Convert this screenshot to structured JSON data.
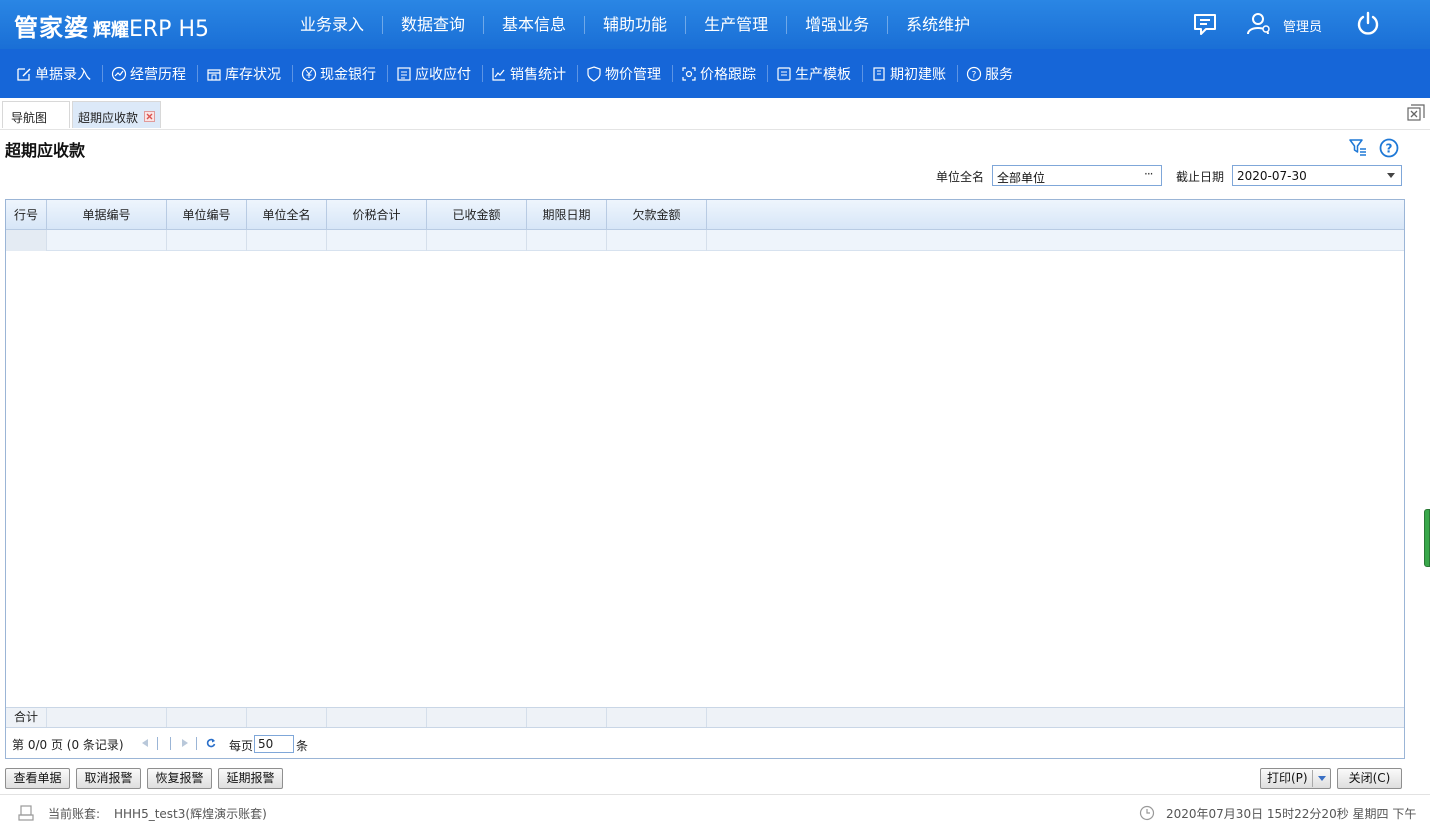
{
  "header": {
    "logo_main": "管家婆",
    "logo_brand": "辉耀",
    "logo_product": "ERP H5",
    "nav": [
      "业务录入",
      "数据查询",
      "基本信息",
      "辅助功能",
      "生产管理",
      "增强业务",
      "系统维护"
    ],
    "user": "管理员"
  },
  "toolbar": [
    {
      "label": "单据录入",
      "icon": "edit-icon"
    },
    {
      "label": "经营历程",
      "icon": "trend-icon"
    },
    {
      "label": "库存状况",
      "icon": "warehouse-icon"
    },
    {
      "label": "现金银行",
      "icon": "yen-icon"
    },
    {
      "label": "应收应付",
      "icon": "ledger-icon"
    },
    {
      "label": "销售统计",
      "icon": "chart-icon"
    },
    {
      "label": "物价管理",
      "icon": "shield-icon"
    },
    {
      "label": "价格跟踪",
      "icon": "target-icon"
    },
    {
      "label": "生产模板",
      "icon": "template-icon"
    },
    {
      "label": "期初建账",
      "icon": "book-icon"
    },
    {
      "label": "服务",
      "icon": "help-icon"
    }
  ],
  "tabs": {
    "nav": "导航图",
    "active": "超期应收款"
  },
  "page": {
    "title": "超期应收款"
  },
  "filters": {
    "unit_label": "单位全名",
    "unit_value": "全部单位",
    "unit_button": "···",
    "date_label": "截止日期",
    "date_value": "2020-07-30"
  },
  "grid": {
    "columns": [
      "行号",
      "单据编号",
      "单位编号",
      "单位全名",
      "价税合计",
      "已收金额",
      "期限日期",
      "欠款金额"
    ],
    "rows": [],
    "footer_label": "合计"
  },
  "pager": {
    "info": "第 0/0 页 (0 条记录)",
    "per_page_label": "每页",
    "per_page_value": "50",
    "unit": "条"
  },
  "actions": {
    "view": "查看单据",
    "cancel_alert": "取消报警",
    "restore_alert": "恢复报警",
    "delay_alert": "延期报警",
    "print": "打印(P)",
    "close": "关闭(C)"
  },
  "status": {
    "account_label": "当前账套:",
    "account_value": "HHH5_test3(辉煌演示账套)",
    "datetime": "2020年07月30日 15时22分20秒 星期四 下午"
  }
}
